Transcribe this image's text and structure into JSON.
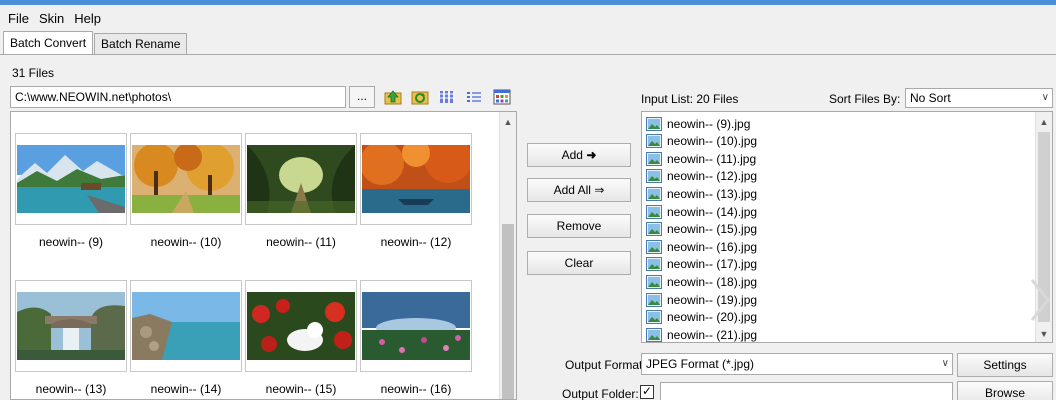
{
  "menu": [
    "File",
    "Skin",
    "Help"
  ],
  "tabs": [
    {
      "label": "Batch Convert",
      "active": true
    },
    {
      "label": "Batch Rename",
      "active": false
    }
  ],
  "files_count": "31 Files",
  "path": "C:\\www.NEOWIN.net\\photos\\",
  "browse_dots": "...",
  "toolbar_icons": [
    "folder-up-icon",
    "refresh-folder-icon",
    "thumbnail-view-icon",
    "list-view-icon",
    "grid-view-icon"
  ],
  "thumbnails": [
    {
      "label": "neowin-- (9)",
      "scene": "lake-mountains"
    },
    {
      "label": "neowin-- (10)",
      "scene": "autumn-trees"
    },
    {
      "label": "neowin-- (11)",
      "scene": "forest-path"
    },
    {
      "label": "neowin-- (12)",
      "scene": "autumn-lake"
    },
    {
      "label": "neowin-- (13)",
      "scene": "waterfall-bridge"
    },
    {
      "label": "neowin-- (14)",
      "scene": "coast"
    },
    {
      "label": "neowin-- (15)",
      "scene": "red-flowers"
    },
    {
      "label": "neowin-- (16)",
      "scene": "flower-field"
    }
  ],
  "buttons": {
    "add": "Add",
    "add_all": "Add All",
    "remove": "Remove",
    "clear": "Clear",
    "settings": "Settings",
    "browse": "Browse"
  },
  "input_list": {
    "label": "Input List:",
    "count": "20 Files",
    "sort_label": "Sort Files By:",
    "sort_value": "No Sort",
    "files": [
      "neowin-- (9).jpg",
      "neowin-- (10).jpg",
      "neowin-- (11).jpg",
      "neowin-- (12).jpg",
      "neowin-- (13).jpg",
      "neowin-- (14).jpg",
      "neowin-- (15).jpg",
      "neowin-- (16).jpg",
      "neowin-- (17).jpg",
      "neowin-- (18).jpg",
      "neowin-- (19).jpg",
      "neowin-- (20).jpg",
      "neowin-- (21).jpg"
    ]
  },
  "output": {
    "format_label": "Output Format:",
    "format_value": "JPEG Format (*.jpg)",
    "folder_label": "Output Folder:",
    "folder_checked": true,
    "folder_value": ""
  },
  "colors": {
    "accent": "#4a8fd8",
    "arrow_green": "#3ea43e"
  }
}
